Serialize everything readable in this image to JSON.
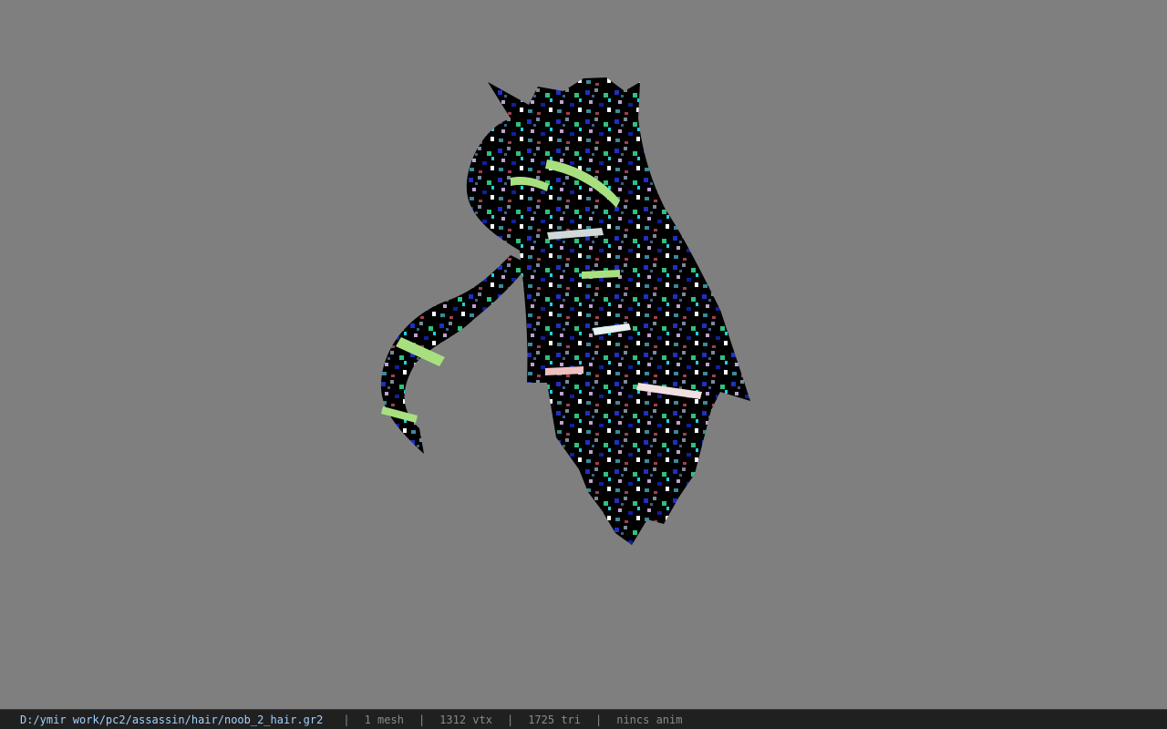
{
  "viewer": {
    "background_color": "#7f7f7f",
    "model_icon": "hair-mesh-model"
  },
  "statusbar": {
    "file_path": "D:/ymir work/pc2/assassin/hair/noob_2_hair.gr2",
    "separator": "|",
    "mesh_count": "1 mesh",
    "vertex_count": "1312 vtx",
    "triangle_count": "1725 tri",
    "animation_state": "nincs anim",
    "path_color": "#9fd0ff",
    "text_color": "#8a8a8a"
  }
}
